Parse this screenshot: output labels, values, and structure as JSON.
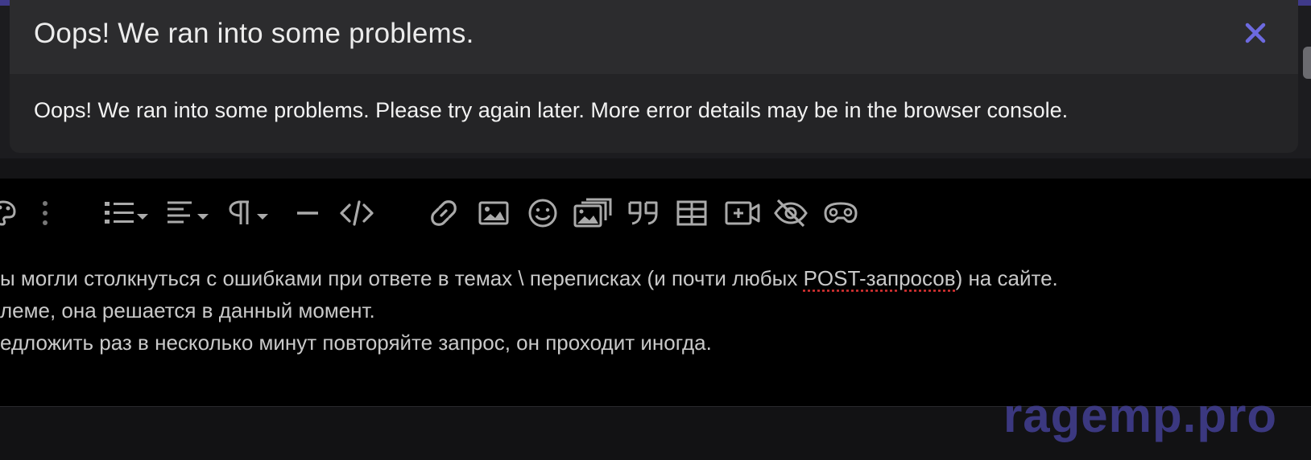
{
  "modal": {
    "title": "Oops! We ran into some problems.",
    "message": "Oops! We ran into some problems. Please try again later. More error details may be in the browser console.",
    "close_icon": "close-icon",
    "accent_color": "#6d6ae0"
  },
  "toolbar": {
    "icons": [
      "palette-icon",
      "more-vertical-icon",
      "list-icon",
      "align-icon",
      "paragraph-icon",
      "horizontal-rule-icon",
      "code-icon",
      "link-icon",
      "image-icon",
      "smiley-icon",
      "media-gallery-icon",
      "quote-icon",
      "table-icon",
      "media-icon",
      "spoiler-icon",
      "game-icon"
    ]
  },
  "editor": {
    "lines": [
      {
        "before": "ы могли столкнуться с ошибками при ответе в темах \\ переписках (и почти любых ",
        "misspelled": "POST-запросов",
        "after": ") на сайте."
      },
      {
        "before": "леме, она решается в данный момент.",
        "misspelled": "",
        "after": ""
      },
      {
        "before": "едложить раз в несколько минут повторяйте запрос, он проходит иногда.",
        "misspelled": "",
        "after": ""
      }
    ]
  },
  "watermark": {
    "text": "ragemp.pro",
    "color": "#3b3880"
  }
}
